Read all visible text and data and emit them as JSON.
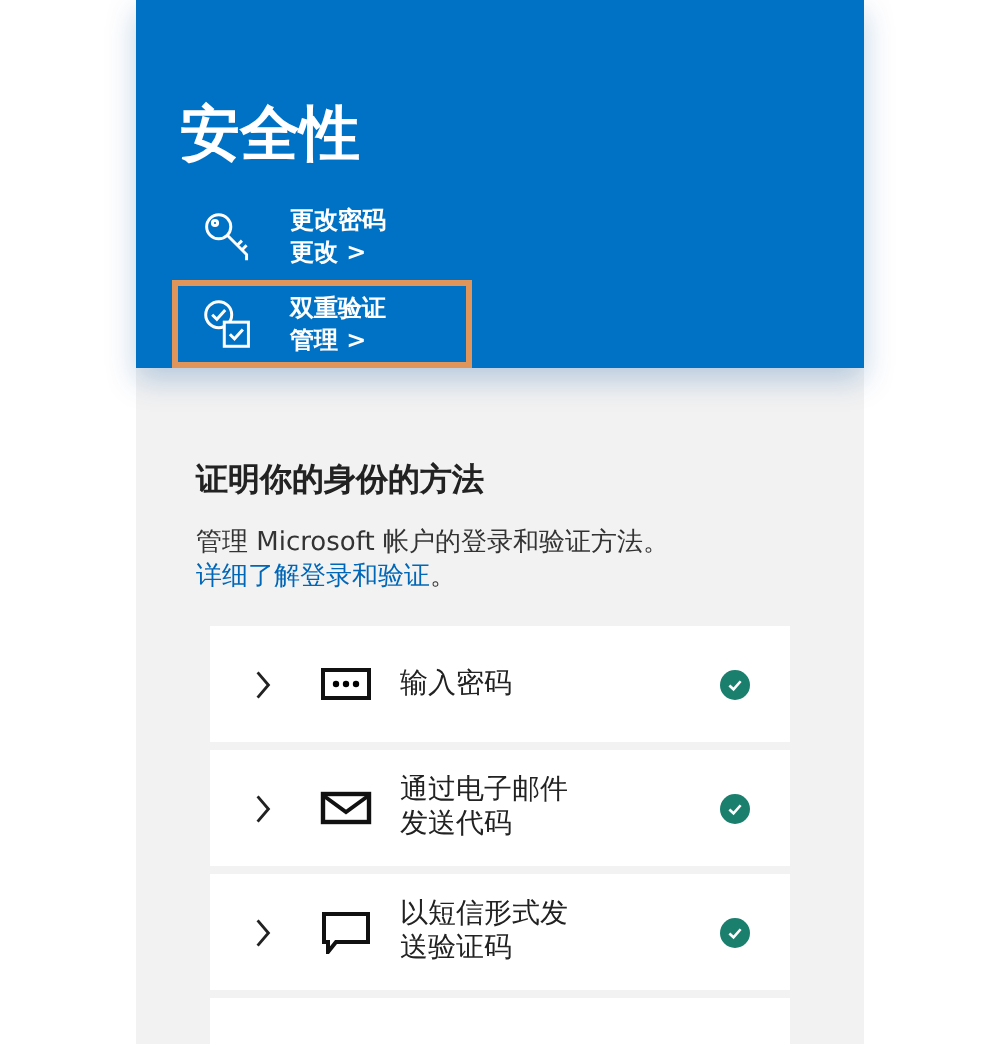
{
  "header": {
    "title": "安全性",
    "items": [
      {
        "kind": "key",
        "title": "更改密码",
        "action": "更改 >",
        "highlighted": false
      },
      {
        "kind": "twostep",
        "title": "双重验证",
        "action": "管理 >",
        "highlighted": true
      }
    ]
  },
  "methods": {
    "heading": "证明你的身份的方法",
    "description": "管理 Microsoft 帐户的登录和验证方法。",
    "link": "详细了解登录和验证",
    "after_link": "。",
    "items": [
      {
        "kind": "password",
        "label": "输入密码",
        "verified": true
      },
      {
        "kind": "email",
        "label": "通过电子邮件发送代码",
        "verified": true
      },
      {
        "kind": "sms",
        "label": "以短信形式发送验证码",
        "verified": true
      },
      {
        "kind": "partial"
      }
    ]
  }
}
